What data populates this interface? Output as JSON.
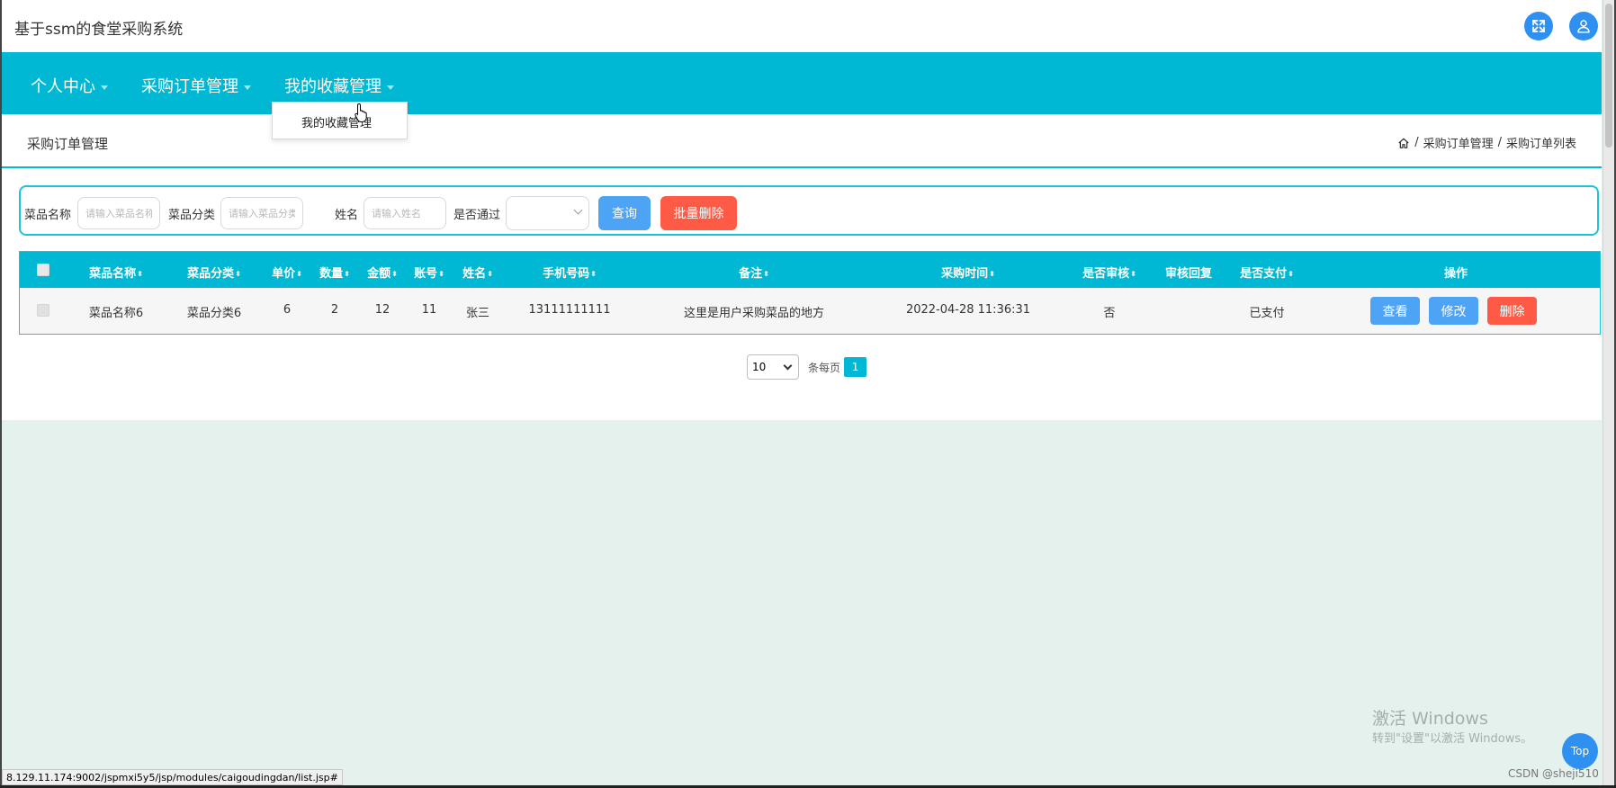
{
  "app": {
    "title": "基于ssm的食堂采购系统"
  },
  "topbar": {
    "fullscreen_icon": "expand-icon",
    "user_icon": "user-icon"
  },
  "nav": {
    "items": [
      {
        "label": "个人中心"
      },
      {
        "label": "采购订单管理"
      },
      {
        "label": "我的收藏管理"
      }
    ],
    "dropdown": {
      "label": "我的收藏管理"
    }
  },
  "page": {
    "title": "采购订单管理",
    "breadcrumb": [
      "采购订单管理",
      "采购订单列表"
    ]
  },
  "search": {
    "dish_name_label": "菜品名称",
    "dish_name_placeholder": "请输入菜品名称",
    "dish_category_label": "菜品分类",
    "dish_category_placeholder": "请输入菜品分类",
    "name_label": "姓名",
    "name_placeholder": "请输入姓名",
    "approved_label": "是否通过",
    "approved_value": "",
    "query_button": "查询",
    "batch_delete_button": "批量删除"
  },
  "table": {
    "sort_glyph": "⬍",
    "columns": [
      "菜品名称",
      "菜品分类",
      "单价",
      "数量",
      "金额",
      "账号",
      "姓名",
      "手机号码",
      "备注",
      "采购时间",
      "是否审核",
      "审核回复",
      "是否支付",
      "操作"
    ],
    "rows": [
      {
        "dish_name": "菜品名称6",
        "dish_category": "菜品分类6",
        "unit_price": "6",
        "quantity": "2",
        "amount": "12",
        "account": "11",
        "name": "张三",
        "phone": "13111111111",
        "remark": "这里是用户采购菜品的地方",
        "purchase_time": "2022-04-28 11:36:31",
        "reviewed": "否",
        "review_reply": "",
        "paid": "已支付",
        "actions": {
          "view": "查看",
          "edit": "修改",
          "delete": "删除"
        }
      }
    ]
  },
  "pagination": {
    "page_size": "10",
    "per_page_label": "条每页",
    "current_page": "1"
  },
  "overlay": {
    "watermark_title": "激活 Windows",
    "watermark_sub": "转到\"设置\"以激活 Windows。",
    "top_button": "Top",
    "status_url": "8.129.11.174:9002/jspmxi5y5/jsp/modules/caigoudingdan/list.jsp#",
    "csdn": "CSDN @sheji510"
  },
  "colors": {
    "primary": "#00b8d4",
    "blue": "#4da3f4",
    "danger": "#ff5a45",
    "page_bg": "#e5f1ec"
  }
}
